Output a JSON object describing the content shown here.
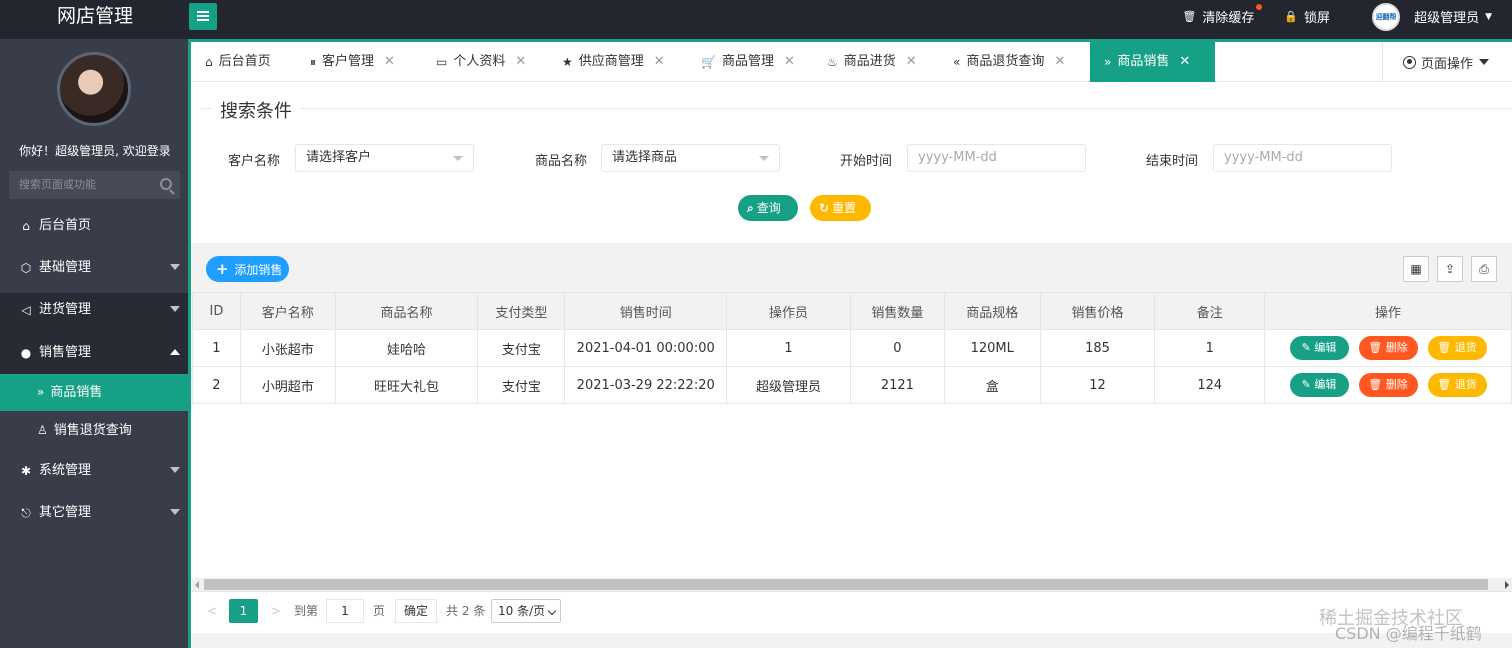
{
  "app": {
    "title": "网店管理"
  },
  "topbar": {
    "clear_cache": "清除缓存",
    "lock": "锁屏",
    "avatar_text": "迎翻帮",
    "user": "超级管理员"
  },
  "sidebar": {
    "welcome": "你好！超级管理员, 欢迎登录",
    "search_placeholder": "搜索页面或功能",
    "items": [
      {
        "label": "后台首页",
        "icon": "home-icon"
      },
      {
        "label": "基础管理",
        "icon": "cube-icon"
      },
      {
        "label": "进货管理",
        "icon": "volume-icon"
      },
      {
        "label": "销售管理",
        "icon": "chat-icon"
      },
      {
        "label": "系统管理",
        "icon": "gear-icon"
      },
      {
        "label": "其它管理",
        "icon": "logout-icon"
      }
    ],
    "sub_items": [
      {
        "label": "商品销售",
        "icon": "double-chevron-icon"
      },
      {
        "label": "销售退货查询",
        "icon": "user-icon"
      }
    ]
  },
  "tabs": [
    {
      "label": "后台首页",
      "icon": "home-icon"
    },
    {
      "label": "客户管理",
      "icon": "pause-icon"
    },
    {
      "label": "个人资料",
      "icon": "id-card-icon"
    },
    {
      "label": "供应商管理",
      "icon": "star-icon"
    },
    {
      "label": "商品管理",
      "icon": "cart-icon"
    },
    {
      "label": "商品进货",
      "icon": "fire-icon"
    },
    {
      "label": "商品退货查询",
      "icon": "double-left-icon"
    },
    {
      "label": "商品销售",
      "icon": "double-right-icon"
    }
  ],
  "page_ops": "页面操作",
  "search": {
    "legend": "搜索条件",
    "customer_label": "客户名称",
    "customer_value": "请选择客户",
    "product_label": "商品名称",
    "product_value": "请选择商品",
    "start_label": "开始时间",
    "start_placeholder": "yyyy-MM-dd",
    "end_label": "结束时间",
    "end_placeholder": "yyyy-MM-dd",
    "query_button": "查询",
    "reset_button": "重置"
  },
  "toolbar": {
    "add_button": "添加销售"
  },
  "table": {
    "columns": [
      "ID",
      "客户名称",
      "商品名称",
      "支付类型",
      "销售时间",
      "操作员",
      "销售数量",
      "商品规格",
      "销售价格",
      "备注",
      "操作"
    ],
    "rows": [
      [
        "1",
        "小张超市",
        "娃哈哈",
        "支付宝",
        "2021-04-01 00:00:00",
        "1",
        "0",
        "120ML",
        "185",
        "1"
      ],
      [
        "2",
        "小明超市",
        "旺旺大礼包",
        "支付宝",
        "2021-03-29 22:22:20",
        "超级管理员",
        "2121",
        "盒",
        "12",
        "124"
      ]
    ],
    "actions": {
      "edit": "编辑",
      "delete": "删除",
      "return": "退货"
    }
  },
  "pager": {
    "current_page": "1",
    "goto_label": "到第",
    "goto_value": "1",
    "page_unit": "页",
    "confirm": "确定",
    "total": "共 2 条",
    "page_size": "10 条/页"
  },
  "watermark": {
    "line1": "稀土掘金技术社区",
    "line2": "CSDN @编程千纸鹤"
  }
}
